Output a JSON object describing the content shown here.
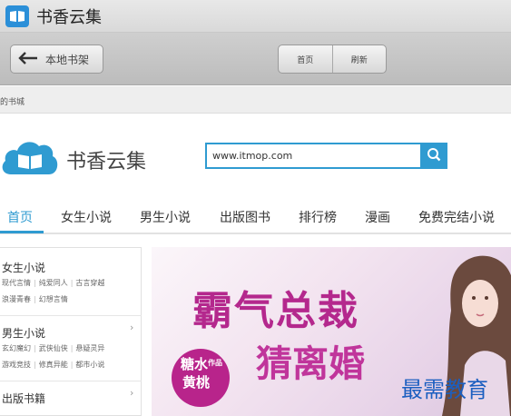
{
  "window": {
    "title": "书香云集"
  },
  "toolbar": {
    "back_label": "本地书架",
    "home_label": "首页",
    "refresh_label": "刷新"
  },
  "bookmark_strip": {
    "text": "的书城"
  },
  "header": {
    "logo_text": "书香云集",
    "search_value": "www.itmop.com"
  },
  "nav": {
    "items": [
      "首页",
      "女生小说",
      "男生小说",
      "出版图书",
      "排行榜",
      "漫画",
      "免费完结小说"
    ],
    "active_index": 0
  },
  "sidebar": {
    "categories": [
      {
        "title": "女生小说",
        "links": [
          "现代言情",
          "纯爱同人",
          "古言穿越",
          "浪漫青春",
          "幻想言情"
        ]
      },
      {
        "title": "男生小说",
        "links": [
          "玄幻魔幻",
          "武侠仙侠",
          "悬疑灵异",
          "游戏竞技",
          "修真异能",
          "都市小说"
        ]
      },
      {
        "title": "出版书籍",
        "links": []
      }
    ]
  },
  "banner": {
    "title_line1": "霸气总裁",
    "title_line2": "猜离婚",
    "author_line1": "糖水",
    "author_line2": "黄桃",
    "author_tag": "作品"
  },
  "watermark": {
    "text": "最需教育"
  },
  "colors": {
    "accent": "#2f9bd1",
    "banner_text": "#b4288d",
    "watermark": "#1c5fc0"
  }
}
